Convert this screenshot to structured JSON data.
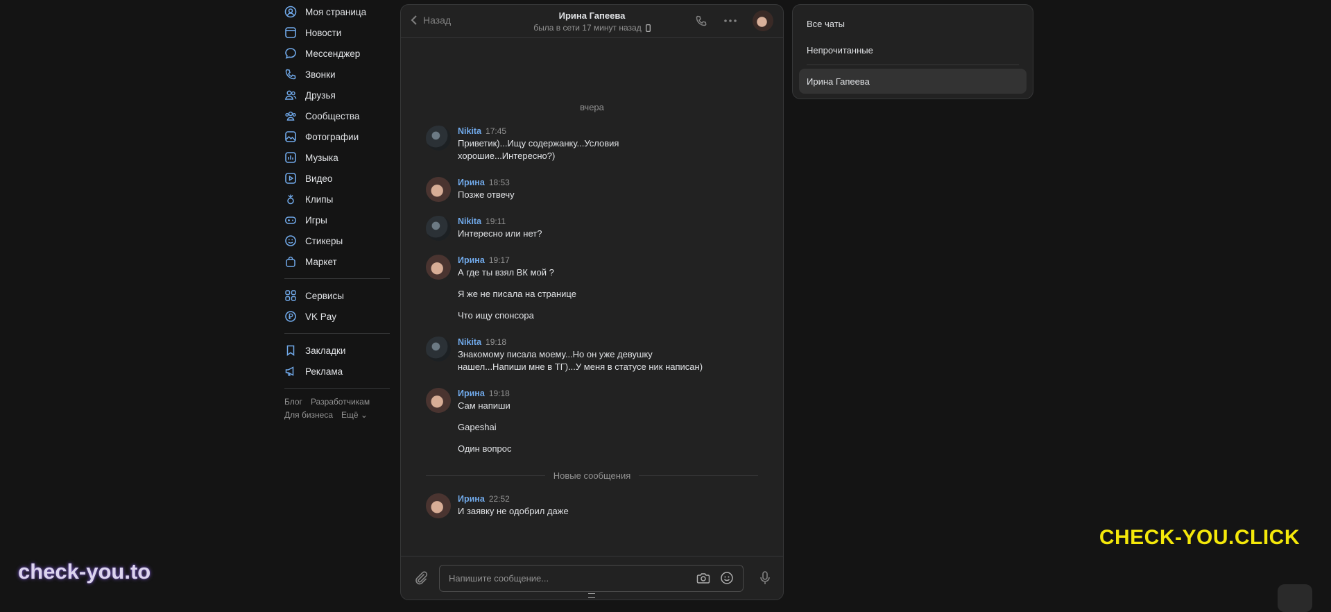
{
  "left_nav": {
    "items": [
      {
        "label": "Моя страница",
        "icon": "user-circle-icon"
      },
      {
        "label": "Новости",
        "icon": "news-icon"
      },
      {
        "label": "Мессенджер",
        "icon": "chat-bubble-icon"
      },
      {
        "label": "Звонки",
        "icon": "phone-icon"
      },
      {
        "label": "Друзья",
        "icon": "friends-icon"
      },
      {
        "label": "Сообщества",
        "icon": "communities-icon"
      },
      {
        "label": "Фотографии",
        "icon": "photo-icon"
      },
      {
        "label": "Музыка",
        "icon": "music-icon"
      },
      {
        "label": "Видео",
        "icon": "video-icon"
      },
      {
        "label": "Клипы",
        "icon": "clips-icon"
      },
      {
        "label": "Игры",
        "icon": "gamepad-icon"
      },
      {
        "label": "Стикеры",
        "icon": "smile-icon"
      },
      {
        "label": "Маркет",
        "icon": "bag-icon"
      }
    ],
    "items2": [
      {
        "label": "Сервисы",
        "icon": "services-grid-icon"
      },
      {
        "label": "VK Pay",
        "icon": "ruble-icon"
      }
    ],
    "items3": [
      {
        "label": "Закладки",
        "icon": "bookmark-icon"
      },
      {
        "label": "Реклама",
        "icon": "megaphone-icon"
      }
    ],
    "footer": {
      "blog": "Блог",
      "dev": "Разработчикам",
      "business": "Для бизнеса",
      "more": "Ещё ⌄"
    }
  },
  "chat": {
    "back_label": "Назад",
    "peer_name": "Ирина Гапеева",
    "peer_status": "была в сети 17 минут назад",
    "day_label": "вчера",
    "new_messages_label": "Новые сообщения",
    "messages": [
      {
        "author": "Nikita",
        "time": "17:45",
        "texts": [
          "Приветик)...Ищу содержанку...Условия хорошие...Интересно?)"
        ]
      },
      {
        "author": "Ирина",
        "time": "18:53",
        "texts": [
          "Позже отвечу"
        ]
      },
      {
        "author": "Nikita",
        "time": "19:11",
        "texts": [
          "Интересно или нет?"
        ]
      },
      {
        "author": "Ирина",
        "time": "19:17",
        "texts": [
          "А где ты взял ВК мой ?",
          "Я же не писала на странице",
          "Что ищу спонсора"
        ]
      },
      {
        "author": "Nikita",
        "time": "19:18",
        "texts": [
          "Знакомому писала моему...Но он уже девушку нашел...Напиши мне в ТГ)...У меня в статусе ник написан)"
        ]
      },
      {
        "author": "Ирина",
        "time": "19:18",
        "texts": [
          "Сам напиши",
          "Gapeshai",
          "Один вопрос"
        ]
      },
      {
        "author": "Ирина",
        "time": "22:52",
        "texts": [
          "И заявку не одобрил даже"
        ]
      }
    ],
    "composer_placeholder": "Напишите сообщение..."
  },
  "filters": {
    "all": "Все чаты",
    "unread": "Непрочитанные",
    "active": "Ирина Гапеева"
  },
  "watermarks": {
    "left": "check-you.to",
    "right": "CHECK-YOU.CLICK"
  },
  "colors": {
    "accent": "#71aaeb",
    "watermark_yellow": "#f4e80a",
    "background": "#141414",
    "panel": "#222222"
  }
}
